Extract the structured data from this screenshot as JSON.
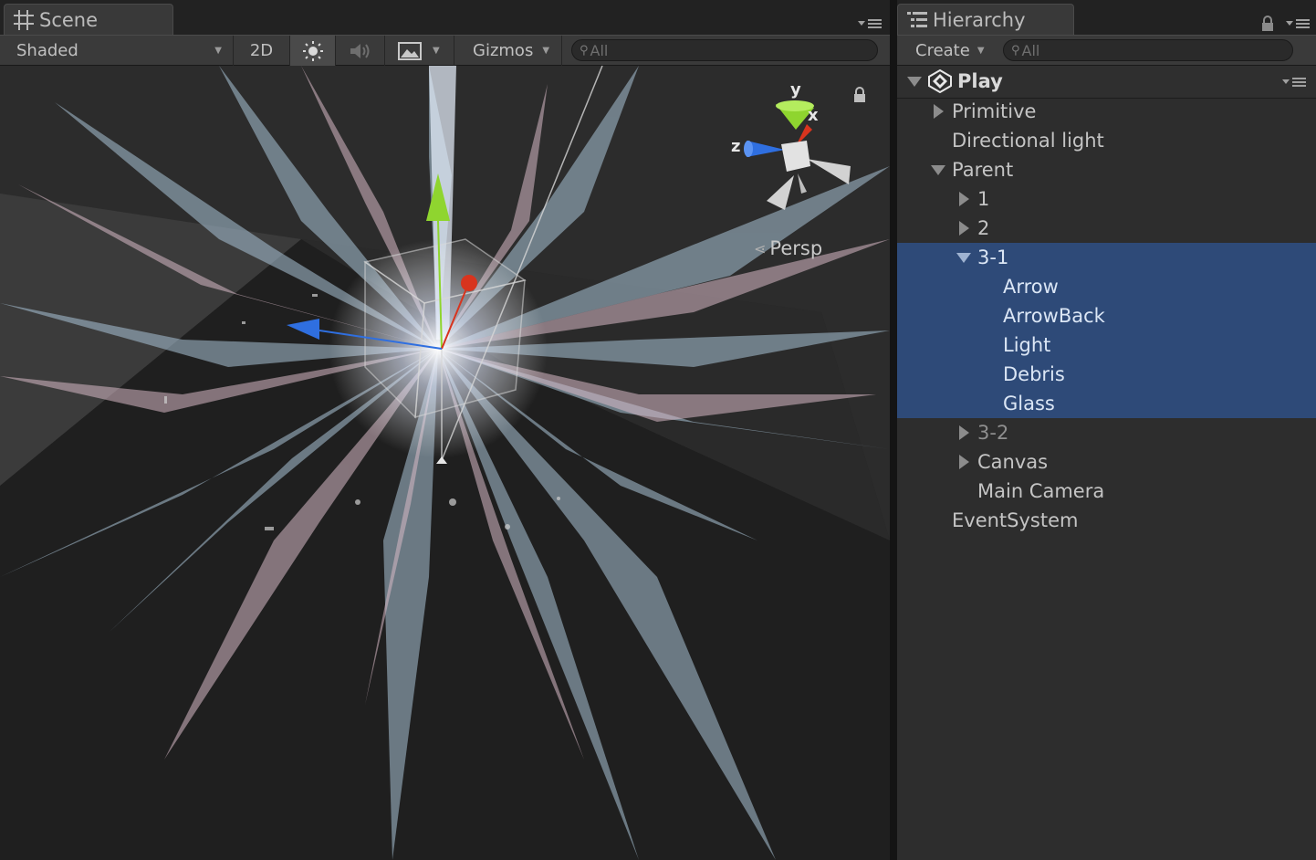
{
  "scene": {
    "tab_label": "Scene",
    "toolbar": {
      "shading_mode": "Shaded",
      "mode_2d": "2D",
      "gizmos_label": "Gizmos",
      "search_placeholder": "All"
    },
    "orientation": {
      "axis_y": "y",
      "axis_x": "x",
      "axis_z": "z",
      "projection": "Persp"
    }
  },
  "hierarchy": {
    "tab_label": "Hierarchy",
    "create_label": "Create",
    "search_placeholder": "All",
    "root": "Play",
    "items": [
      {
        "label": "Primitive",
        "depth": 1,
        "expander": "collapsed",
        "selected": false
      },
      {
        "label": "Directional light",
        "depth": 1,
        "expander": "none",
        "selected": false
      },
      {
        "label": "Parent",
        "depth": 1,
        "expander": "expanded",
        "selected": false
      },
      {
        "label": "1",
        "depth": 2,
        "expander": "collapsed",
        "selected": false
      },
      {
        "label": "2",
        "depth": 2,
        "expander": "collapsed",
        "selected": false
      },
      {
        "label": "3-1",
        "depth": 2,
        "expander": "expanded",
        "selected": true
      },
      {
        "label": "Arrow",
        "depth": 3,
        "expander": "none",
        "selected": true
      },
      {
        "label": "ArrowBack",
        "depth": 3,
        "expander": "none",
        "selected": true
      },
      {
        "label": "Light",
        "depth": 3,
        "expander": "none",
        "selected": true
      },
      {
        "label": "Debris",
        "depth": 3,
        "expander": "none",
        "selected": true
      },
      {
        "label": "Glass",
        "depth": 3,
        "expander": "none",
        "selected": true
      },
      {
        "label": "3-2",
        "depth": 2,
        "expander": "collapsed",
        "selected": false
      },
      {
        "label": "Canvas",
        "depth": 2,
        "expander": "collapsed",
        "selected": false
      },
      {
        "label": "Main Camera",
        "depth": 2,
        "expander": "none",
        "selected": false
      },
      {
        "label": "EventSystem",
        "depth": 1,
        "expander": "none",
        "selected": false
      }
    ]
  },
  "colors": {
    "selection": "#2e4a78",
    "axis_y": "#8fd52f",
    "axis_x": "#d8341e",
    "axis_z": "#2f6fe0"
  }
}
